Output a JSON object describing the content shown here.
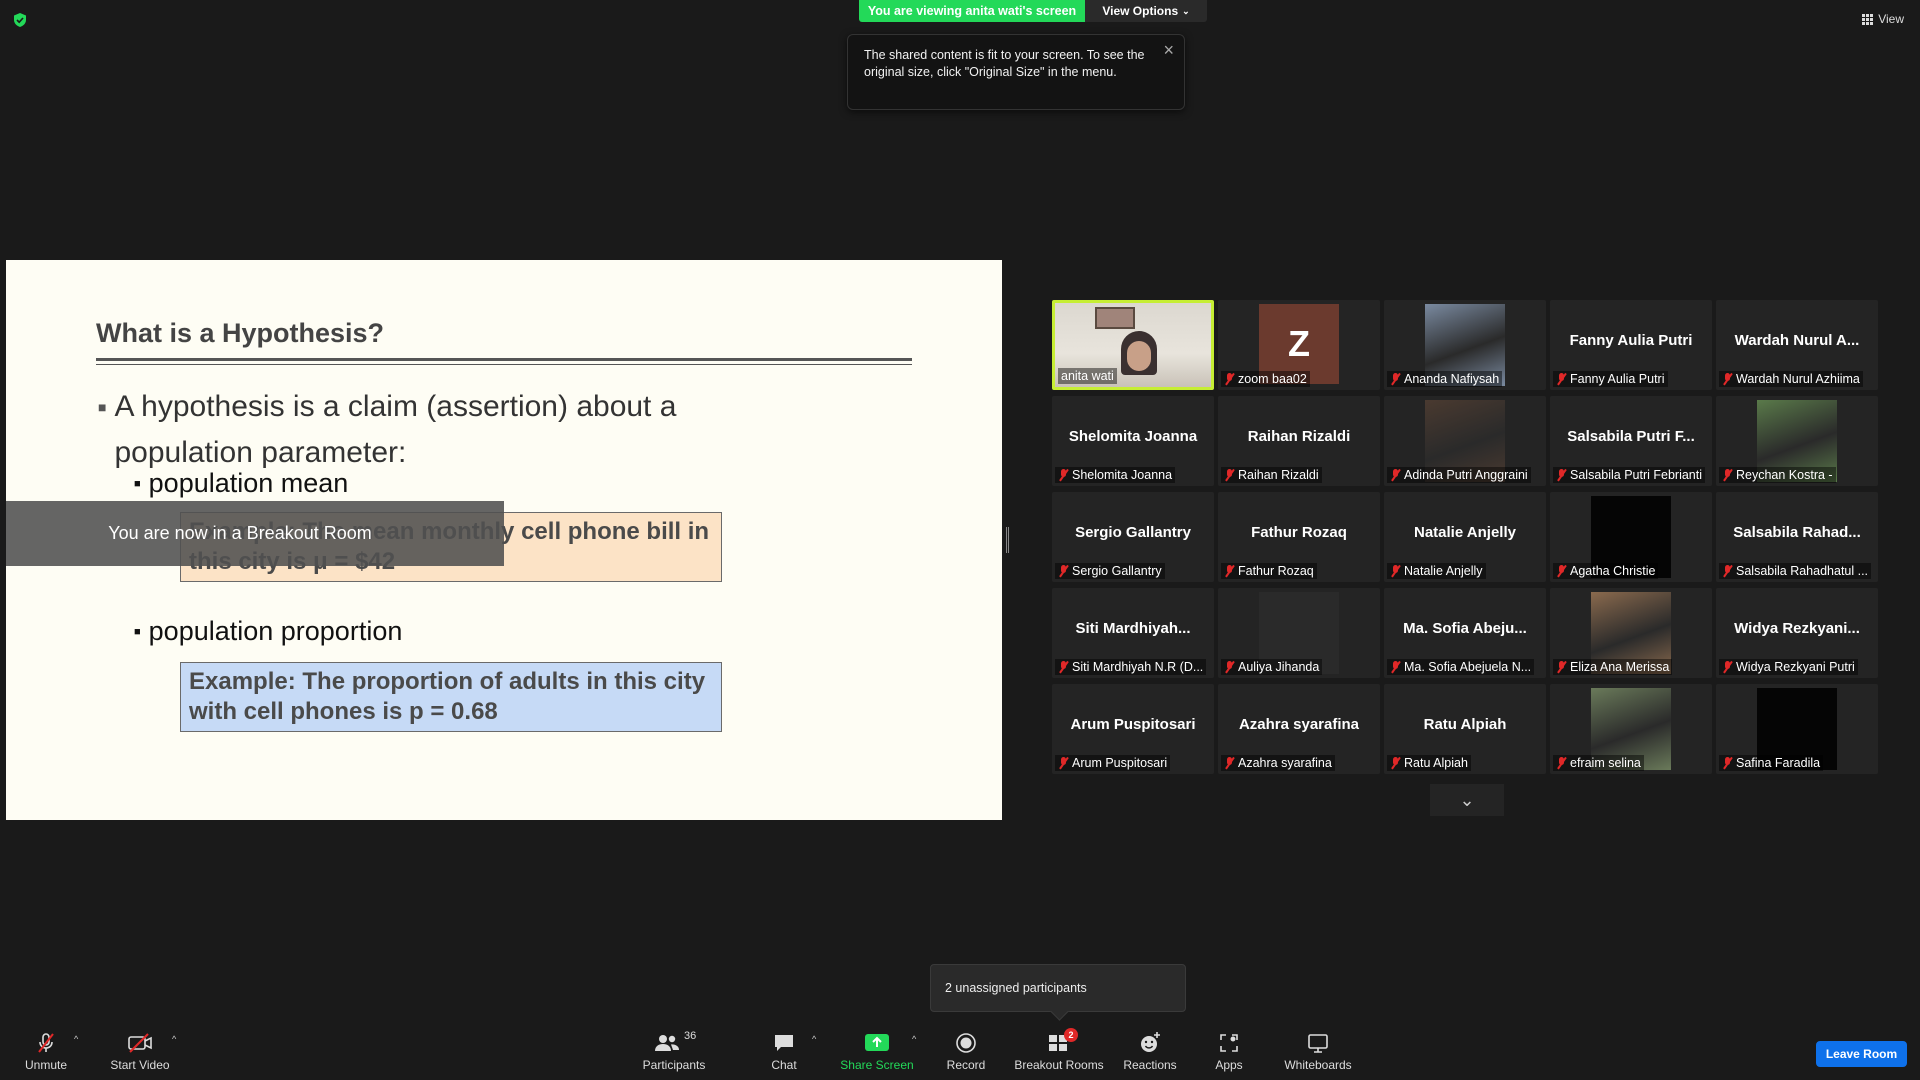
{
  "top": {
    "viewing_banner": "You are viewing anita wati's screen",
    "view_options_label": "View Options",
    "tooltip_text": "The shared content is fit to your screen. To see the original size, click \"Original Size\" in the menu.",
    "view_label": "View"
  },
  "slide": {
    "title": "What is a Hypothesis?",
    "bullet": "A hypothesis is a claim (assertion) about a population parameter:",
    "sub_mean": "population mean",
    "example_mean": "Example:  The mean monthly cell phone bill in this city is  μ = $42",
    "sub_proportion": "population proportion",
    "example_proportion": "Example:  The proportion of adults in this city with cell phones is  p = 0.68"
  },
  "breakout_notice": "You are now in a Breakout Room",
  "participants": [
    {
      "big": "",
      "label": "anita wati",
      "muted": false,
      "type": "video"
    },
    {
      "big": "",
      "label": "zoom baa02",
      "muted": true,
      "type": "avatar",
      "initial": "Z"
    },
    {
      "big": "",
      "label": "Ananda Nafiysah",
      "muted": true,
      "type": "photo"
    },
    {
      "big": "Fanny Aulia Putri",
      "label": "Fanny Aulia Putri",
      "muted": true,
      "type": "name"
    },
    {
      "big": "Wardah  Nurul  A...",
      "label": "Wardah Nurul Azhiima",
      "muted": true,
      "type": "name"
    },
    {
      "big": "Shelomita Joanna",
      "label": "Shelomita Joanna",
      "muted": true,
      "type": "name"
    },
    {
      "big": "Raihan Rizaldi",
      "label": "Raihan Rizaldi",
      "muted": true,
      "type": "name"
    },
    {
      "big": "",
      "label": "Adinda Putri Anggraini",
      "muted": true,
      "type": "photo"
    },
    {
      "big": "Salsabila  Putri  F...",
      "label": "Salsabila Putri Febrianti",
      "muted": true,
      "type": "name"
    },
    {
      "big": "",
      "label": "Reychan Kostra -",
      "muted": true,
      "type": "photo"
    },
    {
      "big": "Sergio Gallantry",
      "label": "Sergio Gallantry",
      "muted": true,
      "type": "name"
    },
    {
      "big": "Fathur Rozaq",
      "label": "Fathur Rozaq",
      "muted": true,
      "type": "name"
    },
    {
      "big": "Natalie Anjelly",
      "label": "Natalie Anjelly",
      "muted": true,
      "type": "name"
    },
    {
      "big": "",
      "label": "Agatha Christie",
      "muted": true,
      "type": "black"
    },
    {
      "big": "Salsabila  Rahad...",
      "label": "Salsabila Rahadhatul ...",
      "muted": true,
      "type": "name"
    },
    {
      "big": "Siti  Mardhiyah...",
      "label": "Siti Mardhiyah N.R (D...",
      "muted": true,
      "type": "name"
    },
    {
      "big": "",
      "label": "Auliya Jihanda",
      "muted": true,
      "type": "photo"
    },
    {
      "big": "Ma.  Sofia  Abeju...",
      "label": "Ma. Sofia Abejuela N...",
      "muted": true,
      "type": "name"
    },
    {
      "big": "",
      "label": "Eliza Ana Merissa",
      "muted": true,
      "type": "photo"
    },
    {
      "big": "Widya  Rezkyani...",
      "label": "Widya Rezkyani Putri",
      "muted": true,
      "type": "name"
    },
    {
      "big": "Arum Puspitosari",
      "label": "Arum Puspitosari",
      "muted": true,
      "type": "name"
    },
    {
      "big": "Azahra syarafina",
      "label": "Azahra syarafina",
      "muted": true,
      "type": "name"
    },
    {
      "big": "Ratu Alpiah",
      "label": "Ratu Alpiah",
      "muted": true,
      "type": "name"
    },
    {
      "big": "",
      "label": "efraim selina",
      "muted": true,
      "type": "photo"
    },
    {
      "big": "",
      "label": "Safina Faradila",
      "muted": true,
      "type": "black"
    }
  ],
  "unassigned_text": "2 unassigned participants",
  "toolbar": {
    "unmute": "Unmute",
    "start_video": "Start Video",
    "participants": "Participants",
    "participants_count": "36",
    "chat": "Chat",
    "share_screen": "Share Screen",
    "record": "Record",
    "breakout_rooms": "Breakout Rooms",
    "breakout_badge": "2",
    "reactions": "Reactions",
    "apps": "Apps",
    "whiteboards": "Whiteboards",
    "leave_room": "Leave Room"
  },
  "colors": {
    "share_green": "#23d959",
    "leave_blue": "#0e71eb",
    "muted_red": "#e02828",
    "active_speaker": "#c6ee34"
  }
}
